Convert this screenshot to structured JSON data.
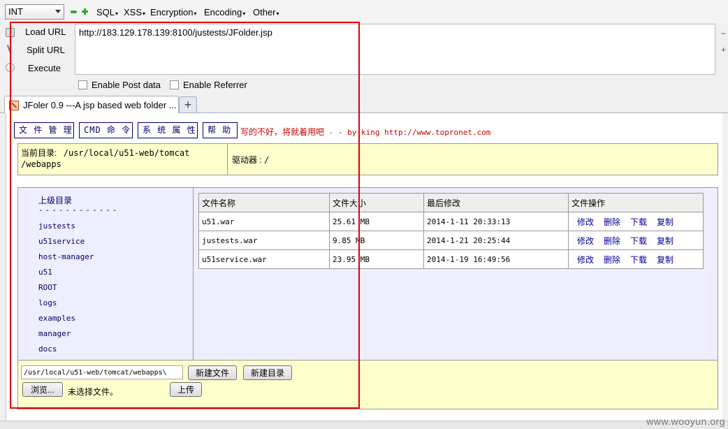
{
  "toolbar": {
    "type_value": "INT",
    "menus": [
      "SQL",
      "XSS",
      "Encryption",
      "Encoding",
      "Other"
    ]
  },
  "actions": {
    "load_url": "Load URL",
    "split_url": "Split URL",
    "execute": "Execute"
  },
  "url_value": "http://183.129.178.139:8100/justests/JFolder.jsp",
  "options": {
    "post_data": "Enable Post data",
    "referrer": "Enable Referrer"
  },
  "tab": {
    "title": "JFoler 0.9 ---A jsp based web folder ...",
    "new_tab": "+"
  },
  "page": {
    "nav": [
      "文 件 管 理",
      "CMD 命 令",
      "系 统 属 性",
      "帮 助"
    ],
    "message_cn": "写的不好，将就着用吧",
    "message_en": " - - by king http://www.topronet.com",
    "curdir_label": "当前目录:",
    "curdir_line1": "/usr/local/u51-web/tomcat",
    "curdir_line2": "/webapps",
    "drive_label": "驱动器 :",
    "drive_value": "/",
    "parent_dir": "上级目录",
    "dashes": "------------",
    "dirs": [
      "justests",
      "u51service",
      "host-manager",
      "u51",
      "ROOT",
      "logs",
      "examples",
      "manager",
      "docs"
    ],
    "table": {
      "headers": [
        "文件名称",
        "文件大小",
        "最后修改",
        "文件操作"
      ],
      "rows": [
        {
          "name": "u51.war",
          "size": "25.61 MB",
          "modified": "2014-1-11 20:33:13"
        },
        {
          "name": "justests.war",
          "size": "9.85 MB",
          "modified": "2014-1-21 20:25:44"
        },
        {
          "name": "u51service.war",
          "size": "23.95 MB",
          "modified": "2014-1-19 16:49:56"
        }
      ],
      "ops": [
        "修改",
        "删除",
        "下载",
        "复制"
      ]
    },
    "path_value": "/usr/local/u51-web/tomcat/webapps\\",
    "new_file": "新建文件",
    "new_dir": "新建目录",
    "browse": "浏览...",
    "no_file": "未选择文件。",
    "upload": "上传"
  },
  "watermark": "www.wooyun.org",
  "colors": {
    "frame": "#e00000",
    "link": "#000066",
    "panel_yellow": "#ffffcc",
    "panel_blue": "#eeeeff",
    "message": "#cc0000"
  }
}
